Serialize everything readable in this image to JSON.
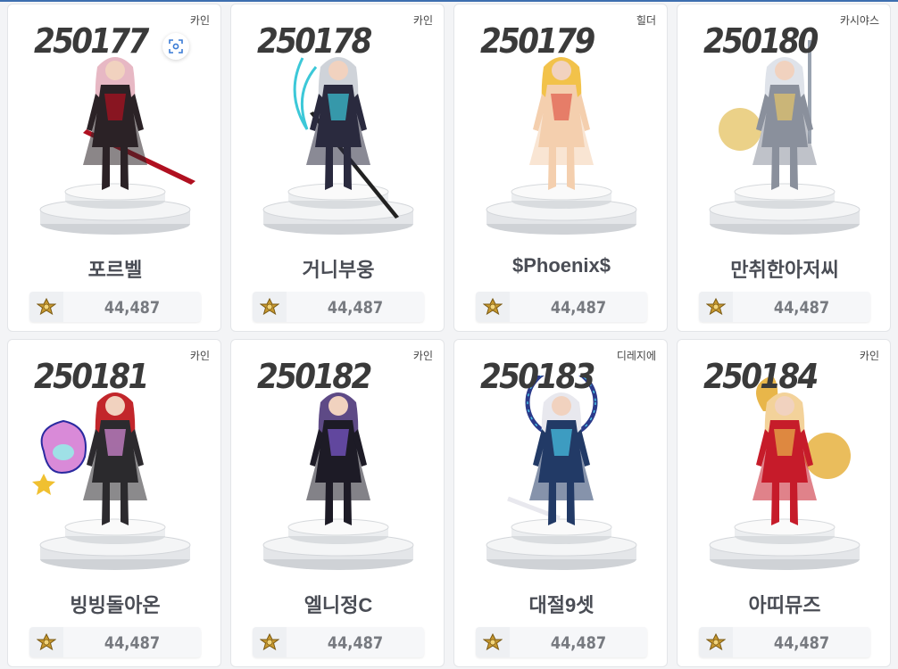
{
  "cards": [
    {
      "rank": "250177",
      "server": "카인",
      "name": "포르벨",
      "score": "44,487",
      "palette": {
        "hair": "#e7b8c4",
        "body": "#2b2226",
        "accent": "#b01020"
      },
      "weapon": "red-sword",
      "has_lens": true
    },
    {
      "rank": "250178",
      "server": "카인",
      "name": "거니부웅",
      "score": "44,487",
      "palette": {
        "hair": "#cfd3d9",
        "body": "#2a2a3e",
        "accent": "#3cc8d8"
      },
      "weapon": "long-blade",
      "has_lens": false
    },
    {
      "rank": "250179",
      "server": "힐더",
      "name": "$Phoenix$",
      "score": "44,487",
      "palette": {
        "hair": "#f2c24a",
        "body": "#f4cfae",
        "accent": "#e05a4a"
      },
      "weapon": "none",
      "has_lens": false
    },
    {
      "rank": "250180",
      "server": "카시야스",
      "name": "만취한아저씨",
      "score": "44,487",
      "palette": {
        "hair": "#dfe3ea",
        "body": "#8a909c",
        "accent": "#e6c56a"
      },
      "weapon": "staff",
      "has_lens": false
    },
    {
      "rank": "250181",
      "server": "카인",
      "name": "빙빙돌아온",
      "score": "44,487",
      "palette": {
        "hair": "#c2262b",
        "body": "#2c2a2e",
        "accent": "#d98ad8"
      },
      "weapon": "pet",
      "has_lens": false
    },
    {
      "rank": "250182",
      "server": "카인",
      "name": "엘니정C",
      "score": "44,487",
      "palette": {
        "hair": "#5e4a86",
        "body": "#1d1b26",
        "accent": "#7f5ad1"
      },
      "weapon": "none",
      "has_lens": false
    },
    {
      "rank": "250183",
      "server": "디레지에",
      "name": "대절9셋",
      "score": "44,487",
      "palette": {
        "hair": "#e8e8ee",
        "body": "#223a66",
        "accent": "#49c6e8"
      },
      "weapon": "ring",
      "has_lens": false
    },
    {
      "rank": "250184",
      "server": "카인",
      "name": "아띠뮤즈",
      "score": "44,487",
      "palette": {
        "hair": "#f3d29a",
        "body": "#c61c2a",
        "accent": "#e8b64a"
      },
      "weapon": "fan",
      "has_lens": false
    }
  ],
  "icons": {
    "medal": "gold-medal-icon",
    "lens": "image-search-icon"
  },
  "colors": {
    "top_accent": "#3d6fb0",
    "medal_gold": "#b88a2a"
  }
}
